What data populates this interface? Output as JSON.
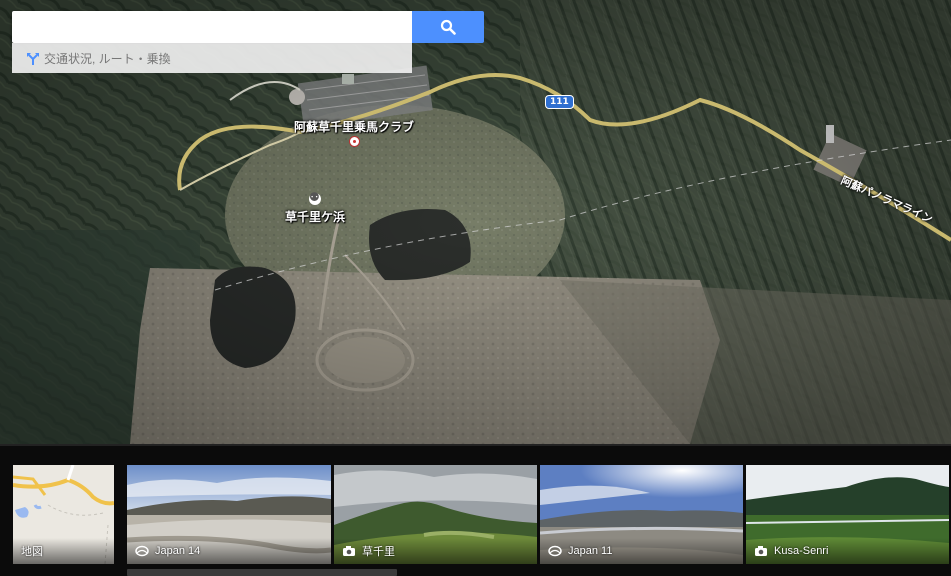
{
  "search": {
    "placeholder": "",
    "directions_text": "交通状況, ルート・乗換"
  },
  "map": {
    "labels": {
      "riding_club": "阿蘇草千里乗馬クラブ",
      "kusasenri": "草千里ケ浜",
      "route_number": "111",
      "panorama_line": "阿蘇パノラマライン"
    }
  },
  "strip": {
    "cards": [
      {
        "label": "地図",
        "icon": "none",
        "kind": "map"
      },
      {
        "label": "Japan 14",
        "icon": "photosphere-icon",
        "kind": "photo"
      },
      {
        "label": "草千里",
        "icon": "camera-icon",
        "kind": "photo"
      },
      {
        "label": "Japan 11",
        "icon": "photosphere-icon",
        "kind": "photo"
      },
      {
        "label": "Kusa-Senri",
        "icon": "camera-icon",
        "kind": "photo"
      }
    ]
  },
  "colors": {
    "search_button": "#4d90fe",
    "road": "#c9b96e",
    "strip_background": "#0b0b0b"
  }
}
